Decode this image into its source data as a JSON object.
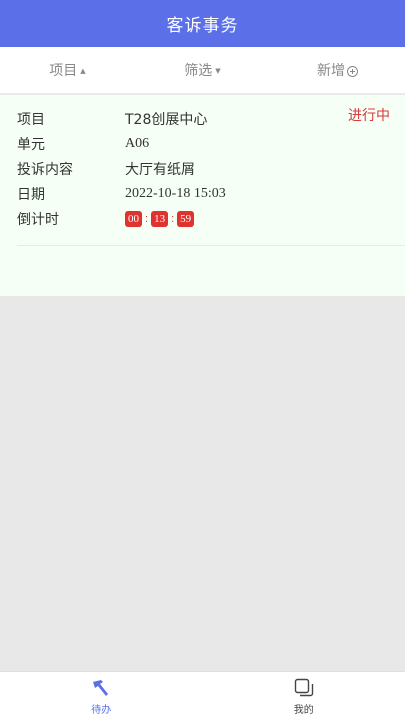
{
  "header": {
    "title": "客诉事务"
  },
  "filters": [
    {
      "label": "项目",
      "icon": "sort-up-icon"
    },
    {
      "label": "筛选",
      "icon": "sort-down-icon"
    },
    {
      "label": "新增",
      "icon": "plus-circle-icon"
    }
  ],
  "card": {
    "status": "进行中",
    "project_label": "项目",
    "project_value": "T28创展中心",
    "unit_label": "单元",
    "unit_value": "A06",
    "content_label": "投诉内容",
    "content_value": "大厅有纸屑",
    "date_label": "日期",
    "date_value": "2022-10-18 15:03",
    "countdown_label": "倒计时",
    "countdown": {
      "hours": "00",
      "minutes": "13",
      "seconds": "59",
      "separator": ":"
    }
  },
  "tabs": [
    {
      "label": "待办",
      "icon": "hammer-icon",
      "active": true
    },
    {
      "label": "我的",
      "icon": "copy-squares-icon",
      "active": false
    }
  ],
  "colors": {
    "primary": "#5a6fe8",
    "status": "#d63a3a",
    "countdown_bg": "#e0332f",
    "card_bg": "#f6fff6"
  }
}
